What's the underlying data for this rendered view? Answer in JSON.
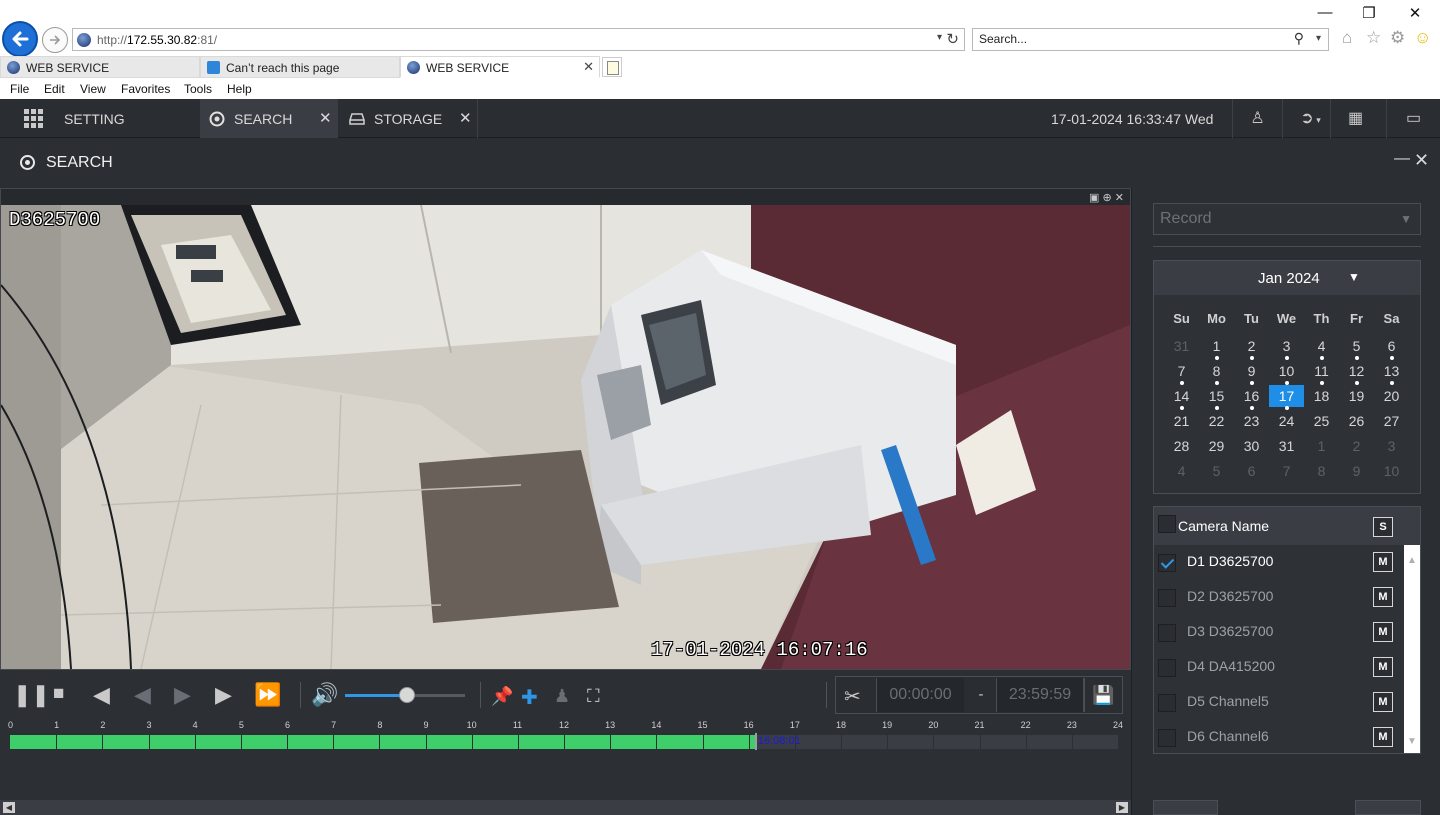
{
  "browser": {
    "url_prefix": "http://",
    "url_host": "172.55.30.82",
    "url_suffix": ":81/",
    "search_placeholder": "Search...",
    "tabs": [
      {
        "label": "WEB SERVICE"
      },
      {
        "label": "Can’t reach this page"
      },
      {
        "label": "WEB SERVICE"
      }
    ],
    "menu": [
      "File",
      "Edit",
      "View",
      "Favorites",
      "Tools",
      "Help"
    ]
  },
  "app": {
    "tabs": [
      {
        "label": "SETTING"
      },
      {
        "label": "SEARCH"
      },
      {
        "label": "STORAGE"
      }
    ],
    "datetime": "17-01-2024 16:33:47 Wed",
    "panel_title": "SEARCH"
  },
  "video": {
    "channel_label": "D3625700",
    "timestamp": "17-01-2024 16:07:16",
    "volume": 0.52
  },
  "clip": {
    "start": "00:00:00",
    "dash": "-",
    "end": "23:59:59"
  },
  "timeline": {
    "hours": [
      "0",
      "1",
      "2",
      "3",
      "4",
      "5",
      "6",
      "7",
      "8",
      "9",
      "10",
      "11",
      "12",
      "13",
      "14",
      "15",
      "16",
      "17",
      "18",
      "19",
      "20",
      "21",
      "22",
      "23",
      "24"
    ],
    "recorded_until_hour": 16.14,
    "cursor_hour": 16.135,
    "cursor_label": "16:08:01",
    "record_color": "#3ecf6a"
  },
  "sidebar": {
    "record_type": "Record",
    "calendar": {
      "month_label": "Jan 2024",
      "dow": [
        "Su",
        "Mo",
        "Tu",
        "We",
        "Th",
        "Fr",
        "Sa"
      ],
      "weeks": [
        [
          {
            "d": "31",
            "o": true
          },
          {
            "d": "1",
            "r": true
          },
          {
            "d": "2",
            "r": true
          },
          {
            "d": "3",
            "r": true
          },
          {
            "d": "4",
            "r": true
          },
          {
            "d": "5",
            "r": true
          },
          {
            "d": "6",
            "r": true
          }
        ],
        [
          {
            "d": "7",
            "r": true
          },
          {
            "d": "8",
            "r": true
          },
          {
            "d": "9",
            "r": true
          },
          {
            "d": "10",
            "r": true
          },
          {
            "d": "11",
            "r": true
          },
          {
            "d": "12",
            "r": true
          },
          {
            "d": "13",
            "r": true
          }
        ],
        [
          {
            "d": "14",
            "r": true
          },
          {
            "d": "15",
            "r": true
          },
          {
            "d": "16",
            "r": true
          },
          {
            "d": "17",
            "r": true,
            "s": true
          },
          {
            "d": "18"
          },
          {
            "d": "19"
          },
          {
            "d": "20"
          }
        ],
        [
          {
            "d": "21"
          },
          {
            "d": "22"
          },
          {
            "d": "23"
          },
          {
            "d": "24"
          },
          {
            "d": "25"
          },
          {
            "d": "26"
          },
          {
            "d": "27"
          }
        ],
        [
          {
            "d": "28"
          },
          {
            "d": "29"
          },
          {
            "d": "30"
          },
          {
            "d": "31"
          },
          {
            "d": "1",
            "o": true
          },
          {
            "d": "2",
            "o": true
          },
          {
            "d": "3",
            "o": true
          }
        ],
        [
          {
            "d": "4",
            "o": true
          },
          {
            "d": "5",
            "o": true
          },
          {
            "d": "6",
            "o": true
          },
          {
            "d": "7",
            "o": true
          },
          {
            "d": "8",
            "o": true
          },
          {
            "d": "9",
            "o": true
          },
          {
            "d": "10",
            "o": true
          }
        ]
      ]
    },
    "camera_header": "Camera Name",
    "sync_label": "S",
    "cameras": [
      {
        "name": "D1 D3625700",
        "checked": true,
        "m": "M"
      },
      {
        "name": "D2 D3625700",
        "checked": false,
        "m": "M"
      },
      {
        "name": "D3 D3625700",
        "checked": false,
        "m": "M"
      },
      {
        "name": "D4 DA415200",
        "checked": false,
        "m": "M"
      },
      {
        "name": "D5 Channel5",
        "checked": false,
        "m": "M"
      },
      {
        "name": "D6 Channel6",
        "checked": false,
        "m": "M"
      }
    ]
  }
}
